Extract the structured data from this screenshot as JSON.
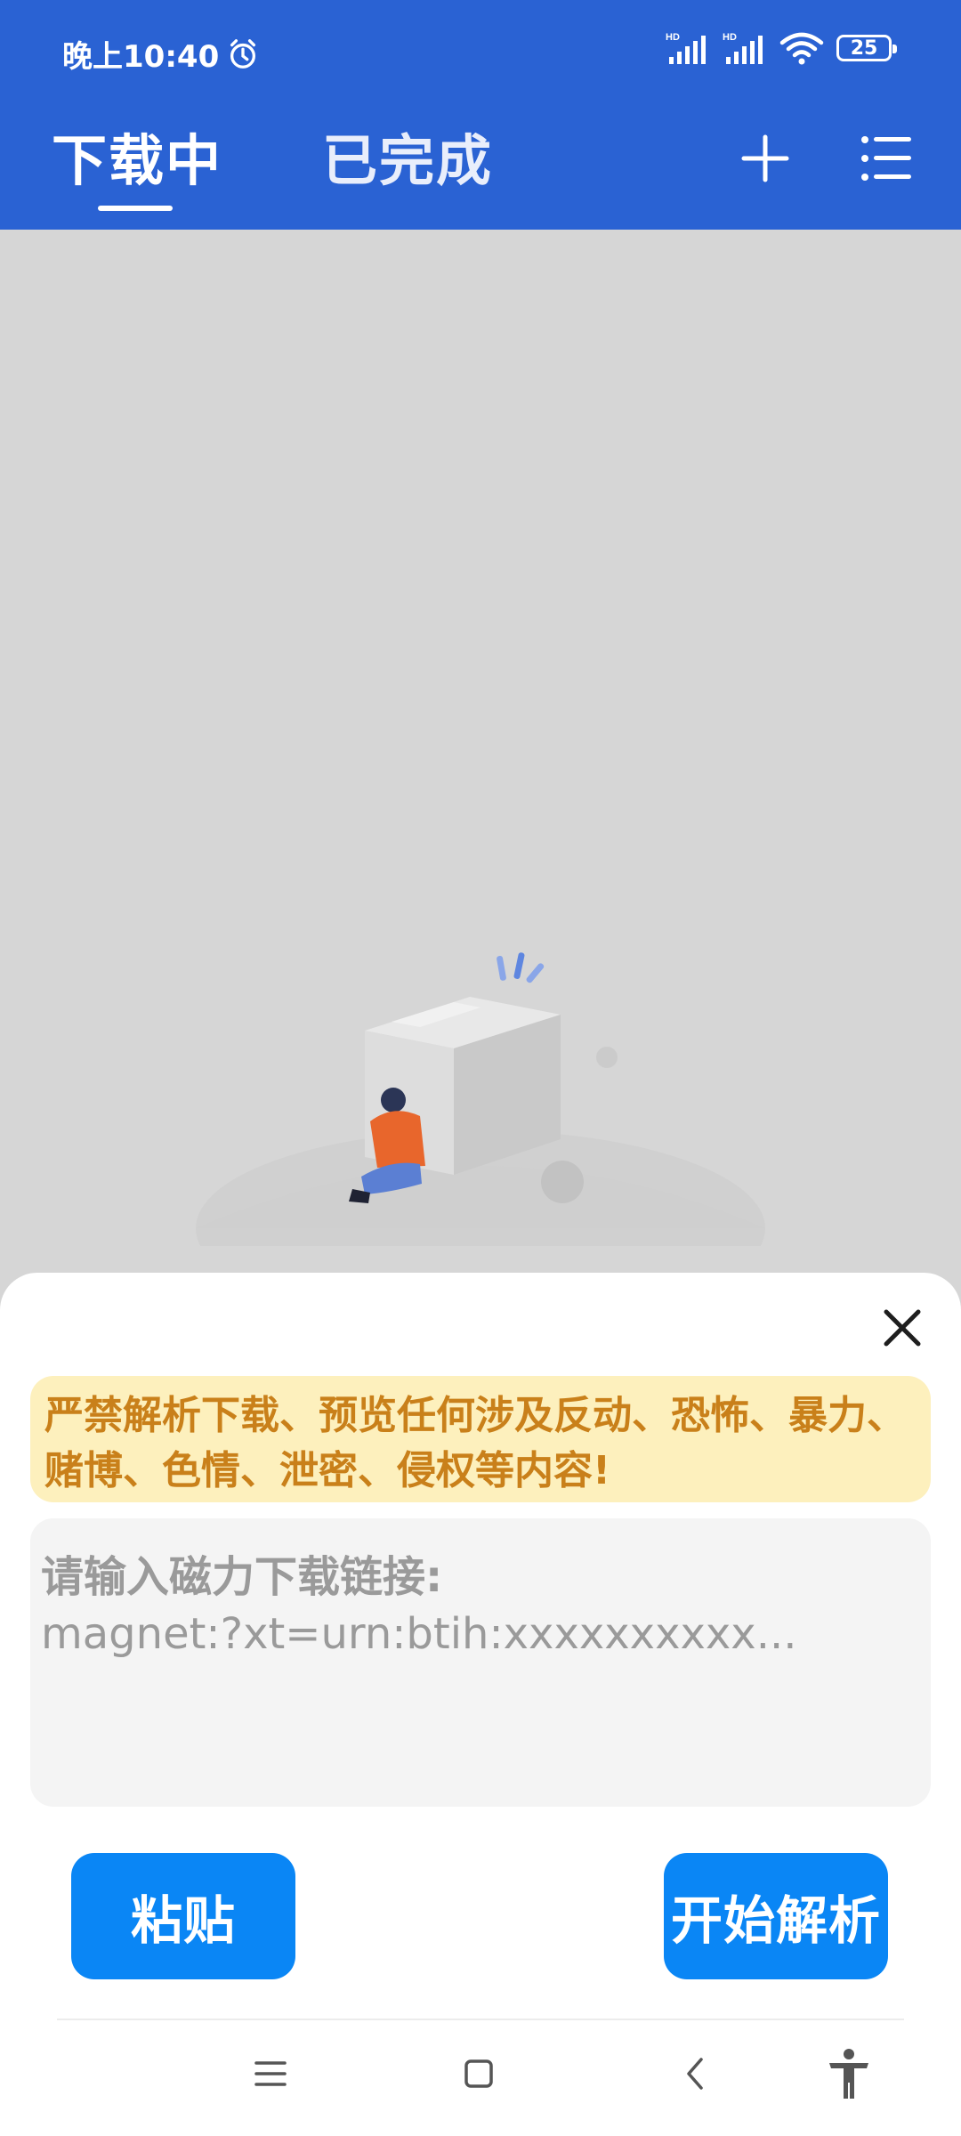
{
  "status_bar": {
    "time": "晚上10:40",
    "battery": "25"
  },
  "tabs": [
    {
      "label": "下载中"
    },
    {
      "label": "已完成"
    }
  ],
  "sheet": {
    "warning": "严禁解析下载、预览任何涉及反动、恐怖、暴力、赌博、色情、泄密、侵权等内容!",
    "input_placeholder_line1": "请输入磁力下载链接:",
    "input_placeholder_line2": "magnet:?xt=urn:btih:xxxxxxxxxx...",
    "paste_label": "粘贴",
    "parse_label": "开始解析"
  },
  "colors": {
    "header": "#2a62d3",
    "accent_button": "#0a86f5",
    "warning_bg": "#fdf0bd",
    "warning_text": "#c9801a"
  },
  "icons": [
    "alarm-icon",
    "signal-icon",
    "wifi-icon",
    "battery-icon",
    "add-icon",
    "menu-icon",
    "close-icon",
    "nav-menu-icon",
    "nav-home-icon",
    "nav-back-icon",
    "accessibility-icon"
  ]
}
